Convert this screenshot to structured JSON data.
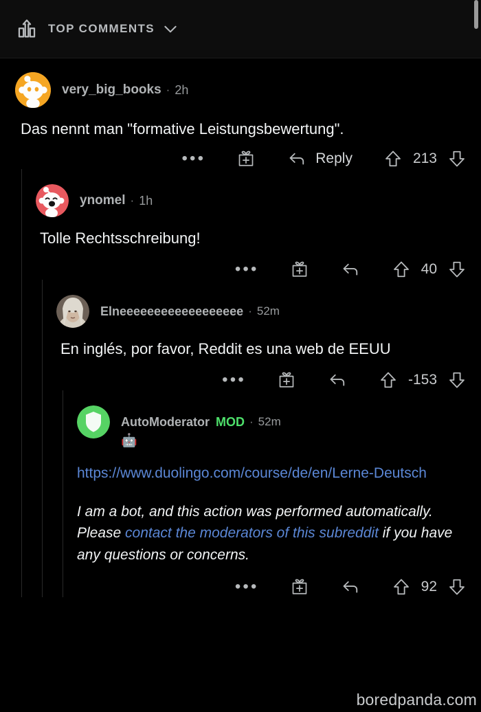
{
  "header": {
    "sort_label": "TOP COMMENTS",
    "trending_icon": "trending-up-icon",
    "chevron_icon": "chevron-down-icon"
  },
  "actions_labels": {
    "overflow": "•••",
    "award_icon": "award-gift-icon",
    "reply_icon": "reply-arrow-icon",
    "reply_label": "Reply",
    "upvote_icon": "upvote-arrow-icon",
    "downvote_icon": "downvote-arrow-icon"
  },
  "colors": {
    "background": "#000000",
    "header_background": "#0d0d0d",
    "text": "#f2f4f5",
    "muted": "#b0b3b5",
    "link": "#5b87d6",
    "mod_green": "#4ee06b",
    "mod_avatar": "#56d364",
    "thread_line": "#2a2a2a"
  },
  "comments": [
    {
      "id": "c1",
      "depth": 0,
      "username": "very_big_books",
      "age": "2h",
      "mod": "",
      "avatar_kind": "snoo-orange",
      "text": "Das nennt man \"formative Leistungsbewertung\".",
      "score": "213",
      "show_reply_label": true
    },
    {
      "id": "c2",
      "depth": 1,
      "username": "ynomel",
      "age": "1h",
      "mod": "",
      "avatar_kind": "snoo-red",
      "text": "Tolle Rechtsschreibung!",
      "score": "40",
      "show_reply_label": false
    },
    {
      "id": "c3",
      "depth": 2,
      "username": "Elneeeeeeeeeeeeeeeeee",
      "age": "52m",
      "mod": "",
      "avatar_kind": "photo-elf",
      "text": "En inglés, por favor, Reddit es una web de EEUU",
      "score": "-153",
      "show_reply_label": false
    },
    {
      "id": "c4",
      "depth": 3,
      "username": "AutoModerator",
      "age": "52m",
      "mod": "MOD",
      "avatar_kind": "shield-green",
      "emoji": "🤖",
      "link_text": "https://www.duolingo.com/course/de/en/Lerne-Deutsch",
      "disclaimer": {
        "part1": "I am a bot, and this action was performed automatically. Please ",
        "link": "contact the moderators of this subreddit",
        "part2": " if you have any questions or concerns."
      },
      "score": "92",
      "show_reply_label": false
    }
  ],
  "watermark": "boredpanda.com"
}
